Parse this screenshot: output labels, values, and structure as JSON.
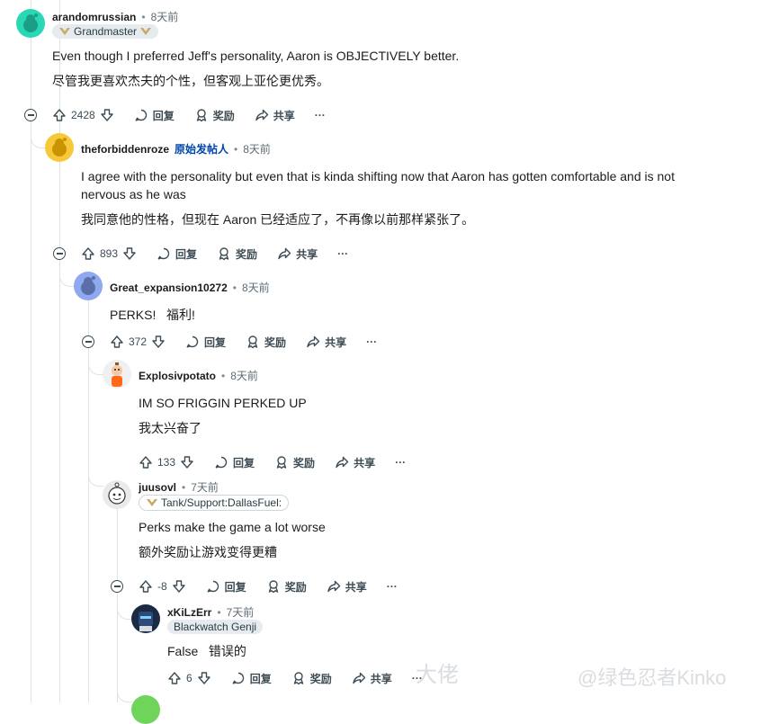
{
  "comments": [
    {
      "username": "arandomrussian",
      "time": "8天前",
      "flair": "Grandmaster",
      "body_en": "Even though I preferred Jeff's personality, Aaron is OBJECTIVELY better.",
      "body_zh": "尽管我更喜欢杰夫的个性，但客观上亚伦更优秀。",
      "score": "2428"
    },
    {
      "username": "theforbiddenroze",
      "op_badge": "原始发帖人",
      "time": "8天前",
      "body_en": "I agree with the personality but even that is kinda shifting now that Aaron has gotten comfortable and is not nervous as he was",
      "body_zh": "我同意他的性格，但现在 Aaron 已经适应了，不再像以前那样紧张了。",
      "score": "893"
    },
    {
      "username": "Great_expansion10272",
      "time": "8天前",
      "body": "PERKS!   福利!",
      "score": "372"
    },
    {
      "username": "Explosivpotato",
      "time": "8天前",
      "body_en": "IM SO FRIGGIN PERKED UP",
      "body_zh": "我太兴奋了",
      "score": "133"
    },
    {
      "username": "juusovl",
      "time": "7天前",
      "flair": "Tank/Support:DallasFuel:",
      "body_en": "Perks make the game a lot worse",
      "body_zh": "额外奖励让游戏变得更糟",
      "score": "-8"
    },
    {
      "username": "xKiLzErr",
      "time": "7天前",
      "flair": "Blackwatch Genji",
      "body": "False   错误的",
      "score": "6"
    }
  ],
  "actions": {
    "reply": "回复",
    "award": "奖励",
    "share": "共享",
    "more": "···"
  },
  "separator": "•",
  "watermark": {
    "left": "大佬",
    "right": "@绿色忍者Kinko"
  },
  "colors": {
    "op": "#0045ac",
    "thread": "#dfe3e6",
    "text": "#1c1c1c",
    "meta": "#5c6c74"
  }
}
